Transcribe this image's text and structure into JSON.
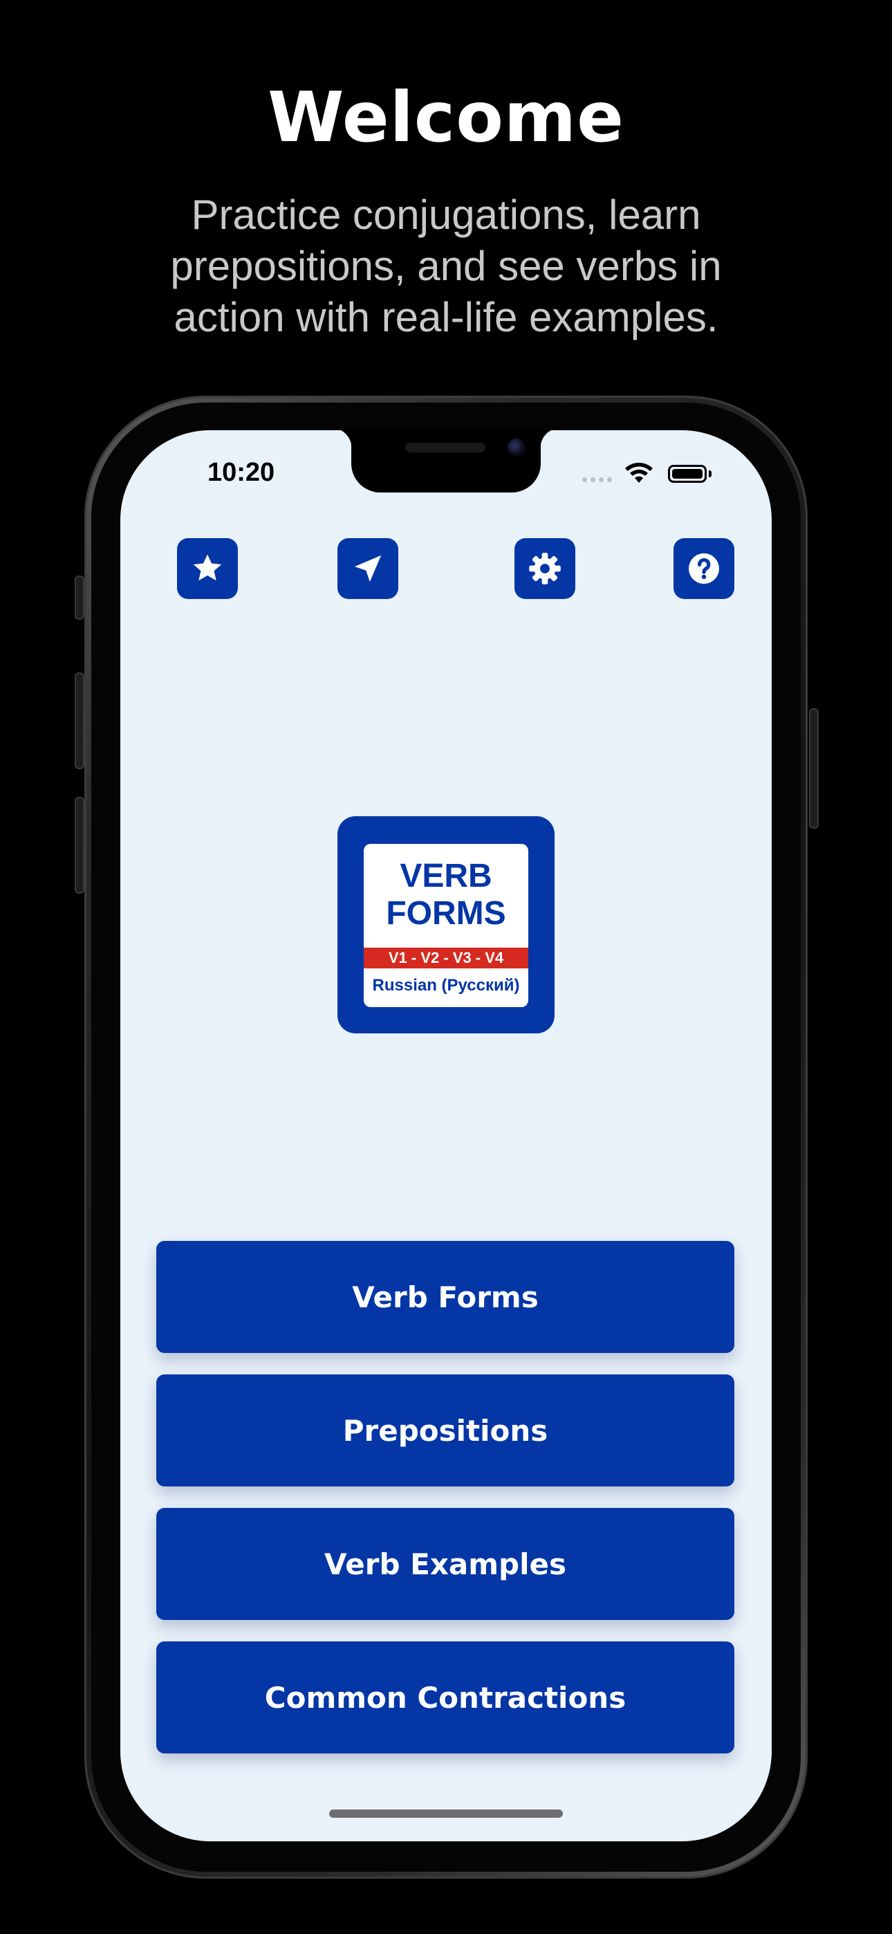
{
  "promo": {
    "title": "Welcome",
    "subtitle": "Practice conjugations, learn prepositions, and see verbs in action with real-life examples."
  },
  "status_bar": {
    "time": "10:20",
    "wifi_icon": "wifi-icon",
    "battery_icon": "battery-icon",
    "battery_level": 1.0
  },
  "toolbar": {
    "icons": [
      "star-icon",
      "location-arrow-icon",
      "gear-icon",
      "question-icon"
    ]
  },
  "logo": {
    "line1": "VERB",
    "line2": "FORMS",
    "band": "V1 - V2 - V3 - V4",
    "language": "Russian (Русский)"
  },
  "menu": {
    "verb_forms": "Verb Forms",
    "prepositions": "Prepositions",
    "verb_examples": "Verb Examples",
    "common_contractions": "Common Contractions"
  },
  "colors": {
    "accent": "#0436a6",
    "screen_bg": "#e9f2f9",
    "band_red": "#d42a1f",
    "page_bg": "#000000"
  }
}
